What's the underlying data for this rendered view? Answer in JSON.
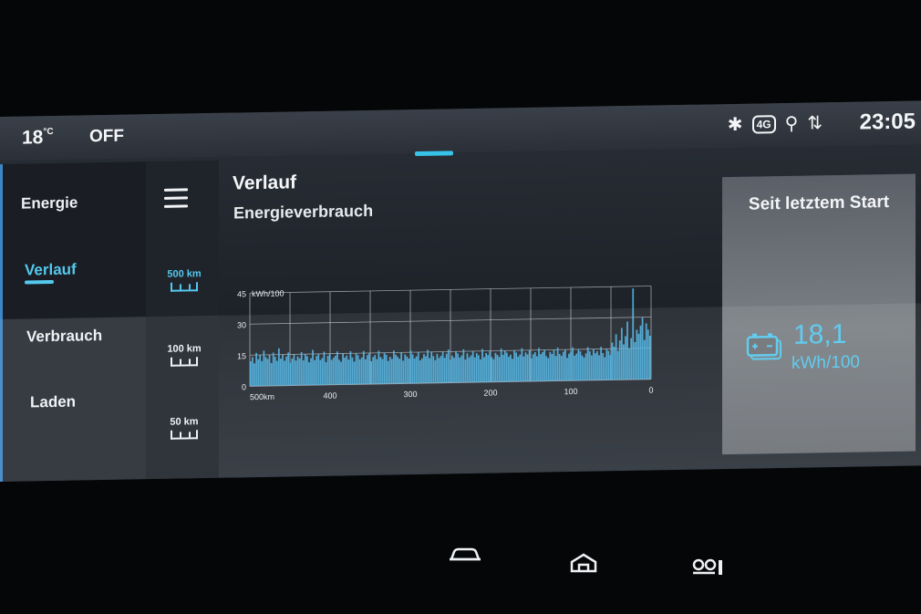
{
  "status_bar": {
    "temperature": "18",
    "temperature_unit": "°C",
    "ac_status": "OFF",
    "network": "4G",
    "time": "23:05"
  },
  "sidebar": {
    "items": [
      {
        "label": "Energie",
        "active": false
      },
      {
        "label": "Verlauf",
        "active": true
      },
      {
        "label": "Verbrauch",
        "active": false
      },
      {
        "label": "Laden",
        "active": false
      }
    ]
  },
  "scale_options": [
    {
      "label": "500 km",
      "active": true
    },
    {
      "label": "100 km",
      "active": false
    },
    {
      "label": "50 km",
      "active": false
    }
  ],
  "main": {
    "title": "Verlauf",
    "subtitle": "Energieverbrauch"
  },
  "chart_data": {
    "type": "bar",
    "ylabel": "kWh/100",
    "ylim": [
      0,
      45
    ],
    "yticks": [
      "0",
      "15",
      "30",
      "45"
    ],
    "xticks": [
      "500km",
      "400",
      "300",
      "200",
      "100",
      "0"
    ],
    "x_reversed": true,
    "x_range": [
      500,
      0
    ],
    "grid": true,
    "color": "#4ab2e4",
    "values": [
      12,
      14,
      11,
      16,
      13,
      15,
      12,
      17,
      14,
      13,
      15,
      11,
      16,
      14,
      12,
      18,
      13,
      15,
      12,
      14,
      16,
      11,
      13,
      15,
      12,
      14,
      13,
      16,
      12,
      15,
      14,
      11,
      13,
      17,
      12,
      14,
      15,
      12,
      13,
      16,
      11,
      14,
      15,
      12,
      13,
      14,
      16,
      12,
      11,
      15,
      13,
      14,
      12,
      16,
      13,
      11,
      15,
      14,
      12,
      13,
      16,
      12,
      14,
      15,
      11,
      13,
      14,
      12,
      16,
      13,
      12,
      15,
      14,
      11,
      13,
      12,
      16,
      14,
      13,
      12,
      15,
      11,
      14,
      13,
      12,
      16,
      14,
      12,
      13,
      15,
      11,
      12,
      14,
      13,
      16,
      12,
      15,
      13,
      11,
      14,
      12,
      13,
      15,
      12,
      14,
      16,
      11,
      13,
      12,
      15,
      14,
      12,
      13,
      16,
      11,
      14,
      12,
      13,
      15,
      12,
      14,
      13,
      11,
      16,
      12,
      14,
      13,
      15,
      12,
      11,
      14,
      13,
      12,
      16,
      13,
      15,
      14,
      12,
      13,
      11,
      15,
      14,
      12,
      13,
      16,
      12,
      14,
      13,
      15,
      11,
      13,
      14,
      12,
      16,
      13,
      14,
      15,
      12,
      11,
      14,
      13,
      15,
      12,
      16,
      13,
      12,
      14,
      15,
      11,
      13,
      14,
      16,
      12,
      13,
      15,
      14,
      12,
      11,
      13,
      16,
      14,
      12,
      15,
      13,
      14,
      12,
      16,
      13,
      11,
      15,
      14,
      12,
      18,
      16,
      22,
      14,
      19,
      25,
      17,
      21,
      28,
      15,
      20,
      44,
      18,
      24,
      22,
      26,
      30,
      19,
      27,
      24,
      21
    ]
  },
  "summary_panel": {
    "title": "Seit letztem Start",
    "value": "18,1",
    "unit": "kWh/100",
    "icon": "battery-icon"
  },
  "bottom_nav": [
    {
      "icon": "car-icon"
    },
    {
      "icon": "home-icon"
    },
    {
      "icon": "apps-icon"
    }
  ],
  "colors": {
    "accent": "#55c8ee"
  }
}
